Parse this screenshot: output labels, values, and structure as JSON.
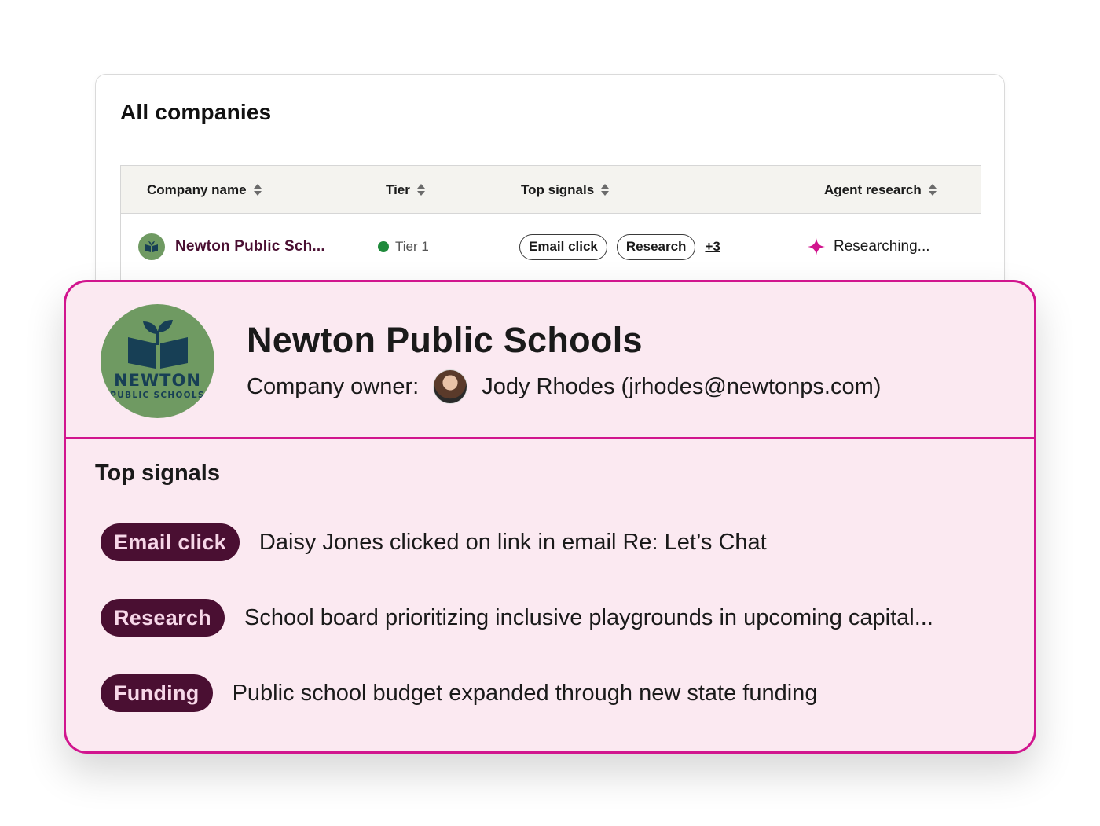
{
  "table_card": {
    "title": "All companies",
    "columns": [
      "Company name",
      "Tier",
      "Top signals",
      "Agent research"
    ],
    "row": {
      "company": "Newton Public Sch...",
      "tier": "Tier 1",
      "chips": [
        "Email click",
        "Research"
      ],
      "more": "+3",
      "research_status": "Researching..."
    }
  },
  "detail_card": {
    "logo_text": "NEWTON",
    "logo_subtext": "PUBLIC SCHOOLS",
    "name": "Newton Public Schools",
    "owner_label": "Company owner:",
    "owner": "Jody Rhodes (jrhodes@newtonps.com)",
    "signals_title": "Top signals",
    "signals": [
      {
        "tag": "Email click",
        "text": "Daisy Jones clicked on link in email Re: Let’s Chat"
      },
      {
        "tag": "Research",
        "text": "School board prioritizing inclusive playgrounds in upcoming capital..."
      },
      {
        "tag": "Funding",
        "text": "Public school budget expanded through new state funding"
      }
    ]
  },
  "colors": {
    "accent": "#d1158e",
    "pill_bg": "#4a0f32",
    "card_bg": "#fbe9f1",
    "tier_dot": "#1f8a3b"
  }
}
